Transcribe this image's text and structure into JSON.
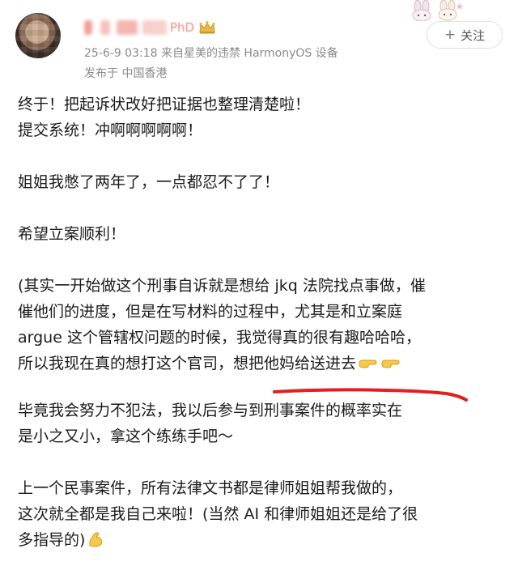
{
  "post": {
    "username_visible": "PhD",
    "meta": {
      "time_and_device": "25-6-9 03:18  来自星美的违禁 HarmonyOS 设备",
      "location": "发布于 中国香港"
    },
    "follow_label": "关注",
    "content_lines": [
      "终于！把起诉状改好把证据也整理清楚啦！",
      "提交系统！冲啊啊啊啊啊！",
      "姐姐我憋了两年了，一点都忍不了了！",
      "希望立案顺利！",
      "(其实一开始做这个刑事自诉就是想给 jkq 法院找点事做，催",
      "催他们的进度，但是在写材料的过程中，尤其是和立案庭",
      "argue 这个管辖权问题的时候，我觉得真的很有趣哈哈哈，",
      "所以我现在真的想打这个官司，想把他妈给送进去",
      "毕竟我会努力不犯法，我以后参与到刑事案件的概率实在",
      "是小之又小，拿这个练练手吧～",
      "上一个民事案件，所有法律文书都是律师姐姐帮我做的，",
      "这次就全都是我自己来啦！(当然 AI 和律师姐姐还是给了很",
      "多指导的)"
    ]
  },
  "icons": {
    "avatar": "avatar-blurred",
    "crown": "crown-icon",
    "follow": "plus-icon",
    "pointing_hands": "pointing-right-hand-icon",
    "flexed_arm": "flexed-biceps-icon",
    "stickers": "bunny-sticker-icon"
  },
  "colors": {
    "meta_text": "#8a8a8a",
    "body_text": "#1b1b1b",
    "annotation_red": "#e0201e",
    "crown_gold": "#e7b84a"
  }
}
